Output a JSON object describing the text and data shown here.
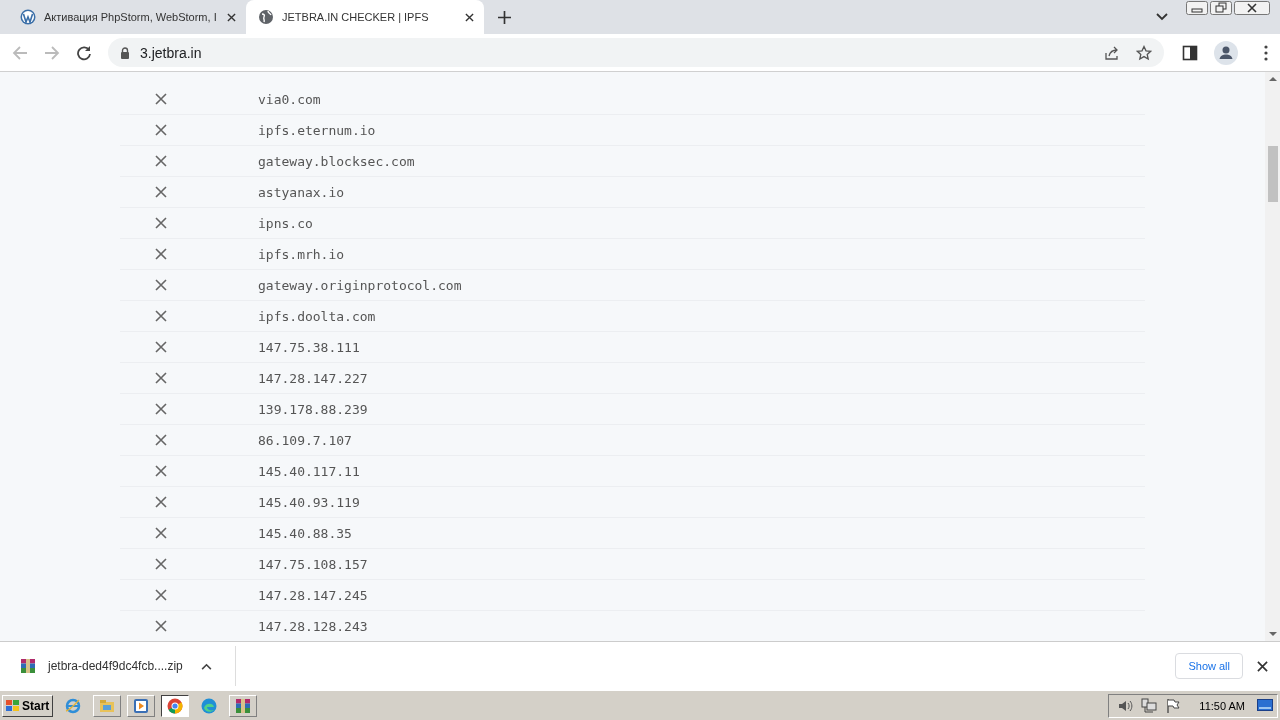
{
  "tabs": [
    {
      "title": "Активация PhpStorm, WebStorm, I",
      "selected": false
    },
    {
      "title": "JETBRA.IN CHECKER | IPFS",
      "selected": true
    }
  ],
  "address": "3.jetbra.in",
  "hosts": [
    {
      "host": "via0.com",
      "reachable": false
    },
    {
      "host": "ipfs.eternum.io",
      "reachable": false
    },
    {
      "host": "gateway.blocksec.com",
      "reachable": false
    },
    {
      "host": "astyanax.io",
      "reachable": false
    },
    {
      "host": "ipns.co",
      "reachable": false
    },
    {
      "host": "ipfs.mrh.io",
      "reachable": false
    },
    {
      "host": "gateway.originprotocol.com",
      "reachable": false
    },
    {
      "host": "ipfs.doolta.com",
      "reachable": false
    },
    {
      "host": "147.75.38.111",
      "reachable": false
    },
    {
      "host": "147.28.147.227",
      "reachable": false
    },
    {
      "host": "139.178.88.239",
      "reachable": false
    },
    {
      "host": "86.109.7.107",
      "reachable": false
    },
    {
      "host": "145.40.117.11",
      "reachable": false
    },
    {
      "host": "145.40.93.119",
      "reachable": false
    },
    {
      "host": "145.40.88.35",
      "reachable": false
    },
    {
      "host": "147.75.108.157",
      "reachable": false
    },
    {
      "host": "147.28.147.245",
      "reachable": false
    },
    {
      "host": "147.28.128.243",
      "reachable": false
    }
  ],
  "download": {
    "filename": "jetbra-ded4f9dc4fcb....zip",
    "show_all": "Show all"
  },
  "taskbar": {
    "start": "Start",
    "apps": [
      {
        "selected": false
      },
      {
        "selected": false
      },
      {
        "selected": false
      },
      {
        "selected": true
      },
      {
        "selected": false
      },
      {
        "selected": false
      }
    ],
    "clock": "11:50 AM"
  }
}
